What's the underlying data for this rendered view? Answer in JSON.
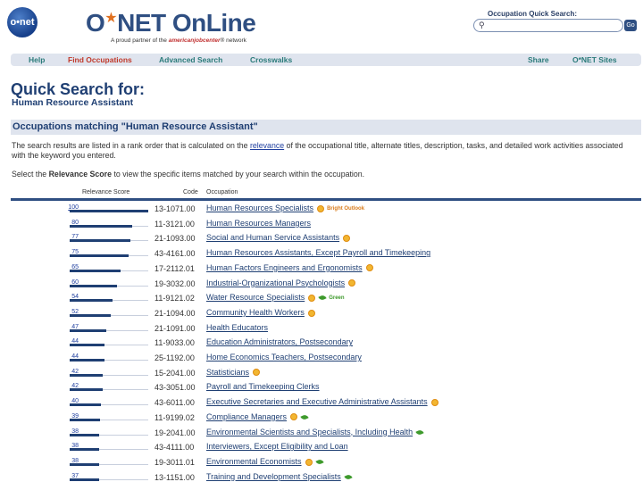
{
  "header": {
    "logo_text": "o•net",
    "brand_o": "O",
    "brand_star": "★",
    "brand_rest": "NET OnLine",
    "partner_prefix": "A proud partner of the",
    "partner_ajc": "americanjobcenter",
    "partner_suffix": "® network",
    "quick_search_label": "Occupation Quick Search:",
    "quick_search_value": "",
    "go_label": "Go"
  },
  "nav": {
    "help": "Help",
    "find": "Find Occupations",
    "advanced": "Advanced Search",
    "crosswalks": "Crosswalks",
    "share": "Share",
    "sites": "O*NET Sites"
  },
  "page": {
    "title": "Quick Search for:",
    "subtitle": "Human Resource Assistant",
    "results_heading": "Occupations matching \"Human Resource Assistant\"",
    "desc_part1": "The search results are listed in a rank order that is calculated on the ",
    "desc_link": "relevance",
    "desc_part2": " of the occupational title, alternate titles, description, tasks, and detailed work activities associated with the keyword you entered.",
    "desc2_part1": "Select the ",
    "desc2_bold": "Relevance Score",
    "desc2_part2": " to view the specific items matched by your search within the occupation."
  },
  "table": {
    "col_relevance": "Relevance Score",
    "col_code": "Code",
    "col_occupation": "Occupation",
    "rows": [
      {
        "score": "100",
        "pct": 100,
        "code": "13-1071.00",
        "occ": "Human Resources Specialists",
        "sun": true,
        "leaf": false,
        "badge": "Bright Outlook",
        "badge_type": "bright"
      },
      {
        "score": "80",
        "pct": 80,
        "code": "11-3121.00",
        "occ": "Human Resources Managers",
        "sun": false,
        "leaf": false,
        "badge": "",
        "badge_type": ""
      },
      {
        "score": "77",
        "pct": 77,
        "code": "21-1093.00",
        "occ": "Social and Human Service Assistants",
        "sun": true,
        "leaf": false,
        "badge": "",
        "badge_type": ""
      },
      {
        "score": "75",
        "pct": 75,
        "code": "43-4161.00",
        "occ": "Human Resources Assistants, Except Payroll and Timekeeping",
        "sun": false,
        "leaf": false,
        "badge": "",
        "badge_type": ""
      },
      {
        "score": "65",
        "pct": 65,
        "code": "17-2112.01",
        "occ": "Human Factors Engineers and Ergonomists",
        "sun": true,
        "leaf": false,
        "badge": "",
        "badge_type": ""
      },
      {
        "score": "60",
        "pct": 60,
        "code": "19-3032.00",
        "occ": "Industrial-Organizational Psychologists",
        "sun": true,
        "leaf": false,
        "badge": "",
        "badge_type": ""
      },
      {
        "score": "54",
        "pct": 54,
        "code": "11-9121.02",
        "occ": "Water Resource Specialists",
        "sun": true,
        "leaf": true,
        "badge": "Green",
        "badge_type": "green"
      },
      {
        "score": "52",
        "pct": 52,
        "code": "21-1094.00",
        "occ": "Community Health Workers",
        "sun": true,
        "leaf": false,
        "badge": "",
        "badge_type": ""
      },
      {
        "score": "47",
        "pct": 47,
        "code": "21-1091.00",
        "occ": "Health Educators",
        "sun": false,
        "leaf": false,
        "badge": "",
        "badge_type": ""
      },
      {
        "score": "44",
        "pct": 44,
        "code": "11-9033.00",
        "occ": "Education Administrators, Postsecondary",
        "sun": false,
        "leaf": false,
        "badge": "",
        "badge_type": ""
      },
      {
        "score": "44",
        "pct": 44,
        "code": "25-1192.00",
        "occ": "Home Economics Teachers, Postsecondary",
        "sun": false,
        "leaf": false,
        "badge": "",
        "badge_type": ""
      },
      {
        "score": "42",
        "pct": 42,
        "code": "15-2041.00",
        "occ": "Statisticians",
        "sun": true,
        "leaf": false,
        "badge": "",
        "badge_type": ""
      },
      {
        "score": "42",
        "pct": 42,
        "code": "43-3051.00",
        "occ": "Payroll and Timekeeping Clerks",
        "sun": false,
        "leaf": false,
        "badge": "",
        "badge_type": ""
      },
      {
        "score": "40",
        "pct": 40,
        "code": "43-6011.00",
        "occ": "Executive Secretaries and Executive Administrative Assistants",
        "sun": true,
        "leaf": false,
        "badge": "",
        "badge_type": ""
      },
      {
        "score": "39",
        "pct": 39,
        "code": "11-9199.02",
        "occ": "Compliance Managers",
        "sun": true,
        "leaf": true,
        "badge": "",
        "badge_type": ""
      },
      {
        "score": "38",
        "pct": 38,
        "code": "19-2041.00",
        "occ": "Environmental Scientists and Specialists, Including Health",
        "sun": false,
        "leaf": true,
        "badge": "",
        "badge_type": ""
      },
      {
        "score": "38",
        "pct": 38,
        "code": "43-4111.00",
        "occ": "Interviewers, Except Eligibility and Loan",
        "sun": false,
        "leaf": false,
        "badge": "",
        "badge_type": ""
      },
      {
        "score": "38",
        "pct": 38,
        "code": "19-3011.01",
        "occ": "Environmental Economists",
        "sun": true,
        "leaf": true,
        "badge": "",
        "badge_type": ""
      },
      {
        "score": "37",
        "pct": 37,
        "code": "13-1151.00",
        "occ": "Training and Development Specialists",
        "sun": false,
        "leaf": true,
        "badge": "",
        "badge_type": ""
      }
    ]
  }
}
